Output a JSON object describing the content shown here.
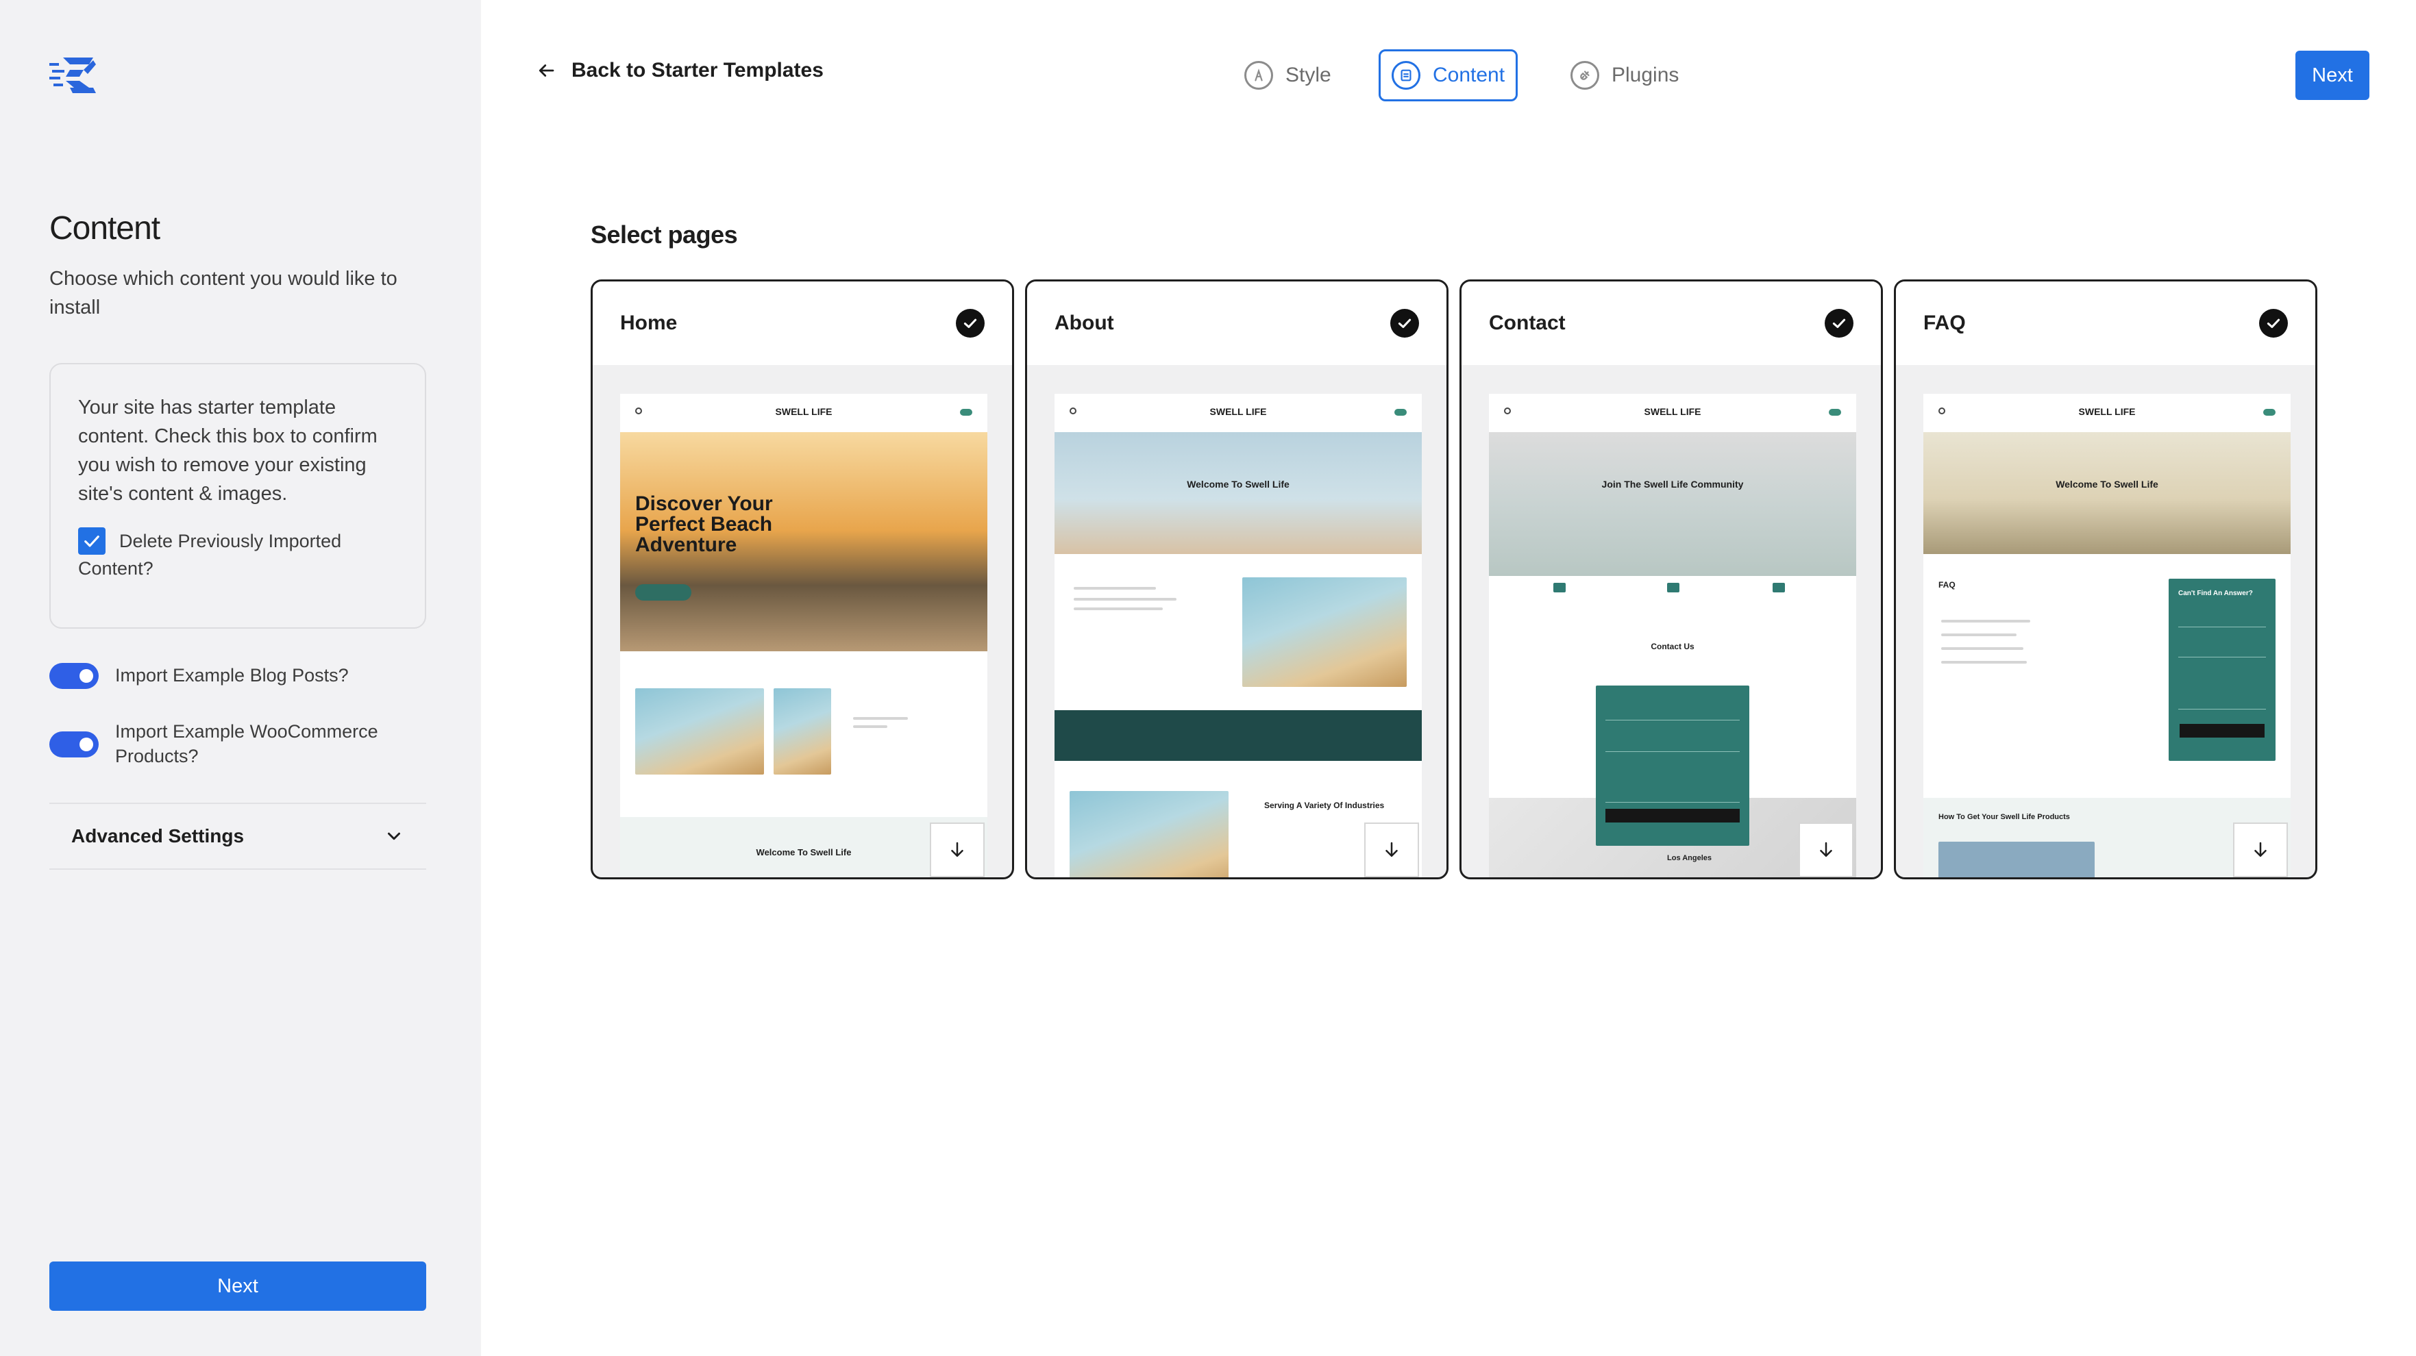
{
  "sidebar": {
    "title": "Content",
    "description": "Choose which content you would like to install",
    "notice": "Your site has starter template content. Check this box to confirm you wish to remove your existing site's content & images.",
    "delete_label_line1": "Delete Previously Imported",
    "delete_label_line2": "Content?",
    "toggle_blog_label": "Import Example Blog Posts?",
    "toggle_woo_line1": "Import Example WooCommerce",
    "toggle_woo_line2": "Products?",
    "advanced_label": "Advanced Settings",
    "next_label": "Next"
  },
  "header": {
    "back_label": "Back to Starter Templates",
    "steps": [
      {
        "label": "Style",
        "icon": "style-icon"
      },
      {
        "label": "Content",
        "icon": "content-icon",
        "active": true
      },
      {
        "label": "Plugins",
        "icon": "plugins-icon"
      }
    ],
    "next_label": "Next"
  },
  "main": {
    "section_title": "Select pages",
    "pages": [
      {
        "name": "Home",
        "selected": true
      },
      {
        "name": "About",
        "selected": true
      },
      {
        "name": "Contact",
        "selected": true
      },
      {
        "name": "FAQ",
        "selected": true
      }
    ]
  },
  "previews": {
    "brand": "SWELL LIFE",
    "home_headline": "Discover Your Perfect Beach Adventure",
    "home_section": "Welcome To Swell Life",
    "about_hero": "Welcome To Swell Life",
    "about_section": "Serving A Variety Of Industries",
    "contact_hero": "Join The Swell Life Community",
    "contact_section": "Contact Us",
    "contact_map": "Los Angeles",
    "faq_hero": "Welcome To Swell Life",
    "faq_title": "FAQ",
    "faq_form_title": "Can't Find An Answer?",
    "faq_section": "How To Get Your Swell Life Products"
  },
  "colors": {
    "accent": "#2271e4",
    "toggle": "#2f5fe6",
    "sidebar_bg": "#f2f2f4",
    "teal": "#2f7a72"
  }
}
